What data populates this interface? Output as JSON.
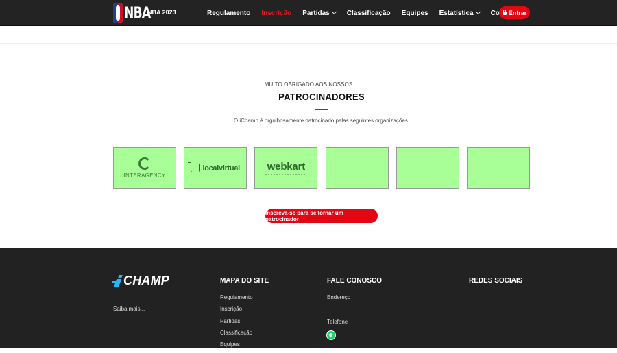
{
  "header": {
    "brand_sub": "NBA 2023",
    "nav": [
      {
        "label": "Regulamento",
        "dropdown": false,
        "active": false
      },
      {
        "label": "Inscrição",
        "dropdown": false,
        "active": true
      },
      {
        "label": "Partidas",
        "dropdown": true,
        "active": false
      },
      {
        "label": "Classificação",
        "dropdown": false,
        "active": false
      },
      {
        "label": "Equipes",
        "dropdown": false,
        "active": false
      },
      {
        "label": "Estatística",
        "dropdown": true,
        "active": false
      },
      {
        "label": "Contato",
        "dropdown": false,
        "active": false
      }
    ],
    "login_label": "Entrar",
    "login_icon": "lock-icon"
  },
  "sponsors_section": {
    "pre_title": "MUITO OBRIGADO AOS NOSSOS",
    "title": "PATROCINADORES",
    "description": "O iChamp é orgulhosamente patrocinado pelas seguintes organizações.",
    "sponsors": [
      {
        "logo_text": "INTERAGENCY"
      },
      {
        "logo_text": "localvirtual"
      },
      {
        "logo_text": "webkart"
      },
      {
        "logo_text": ""
      },
      {
        "logo_text": ""
      },
      {
        "logo_text": ""
      }
    ],
    "cta_label": "Inscreva-se para se tornar um patrocinador"
  },
  "footer": {
    "saiba_mais": "Saiba mais...",
    "sitemap_title": "MAPA DO SITE",
    "sitemap_links": [
      "Regulamento",
      "Inscrição",
      "Partidas",
      "Classificação",
      "Equipes"
    ],
    "contact_title": "FALE CONOSCO",
    "address_label": "Endereço",
    "phone_label": "Telefone",
    "social_title": "REDES SOCIAIS"
  },
  "colors": {
    "topbar": "#232323",
    "accent_red": "#e30613",
    "sponsor_bg": "#a8ff98",
    "footer": "#222222",
    "ichamp_blue": "#29b6f6"
  }
}
